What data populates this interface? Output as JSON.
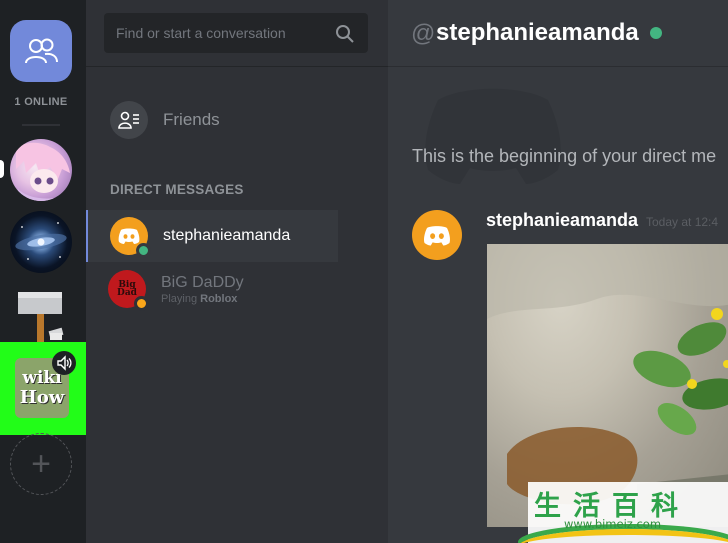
{
  "guild_rail": {
    "online_label": "1 ONLINE",
    "icons": {
      "friends": "friends-icon",
      "add_server": "plus-icon",
      "speaker": "speaker-icon"
    },
    "wikihow": {
      "line1": "wiki",
      "line2": "How"
    },
    "add_symbol": "+"
  },
  "dm_list": {
    "search": {
      "placeholder": "Find or start a conversation",
      "value": ""
    },
    "friends_label": "Friends",
    "header": "DIRECT MESSAGES",
    "items": [
      {
        "name": "stephanieamanda",
        "status": "online",
        "activity": "",
        "active": true
      },
      {
        "name": "BiG DaDDy",
        "status": "idle",
        "activity_prefix": "Playing ",
        "activity_game": "Roblox",
        "active": false
      }
    ],
    "avatar_text": "Big Dad"
  },
  "chat": {
    "at_symbol": "@",
    "username": "stephanieamanda",
    "beginning_text": "This is the beginning of your direct me",
    "message": {
      "author": "stephanieamanda",
      "timestamp": "Today at 12:4"
    }
  },
  "watermark": {
    "chars": "生活百科",
    "url": "www.bimeiz.com"
  },
  "colors": {
    "accent": "#7289da",
    "online": "#43b581",
    "idle": "#faa61a",
    "highlight": "#22fd18",
    "avatar_orange": "#f39f1e"
  }
}
